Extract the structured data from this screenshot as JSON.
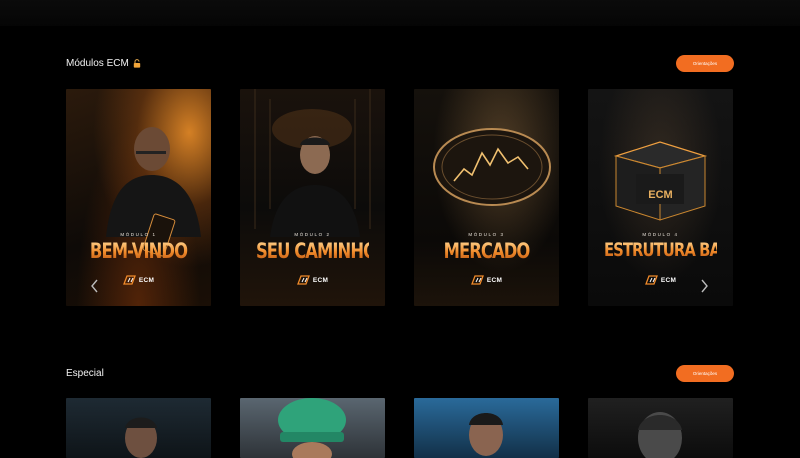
{
  "sections": [
    {
      "title": "Módulos ECM",
      "title_icon": "lock-icon",
      "button_label": "Orientações",
      "cards": [
        {
          "subtitle": "MÓDULO 1",
          "title": "BEM-VINDO",
          "brand": "ECM"
        },
        {
          "subtitle": "MÓDULO 2",
          "title": "SEU CAMINHO",
          "brand": "ECM"
        },
        {
          "subtitle": "MÓDULO 3",
          "title": "MERCADO",
          "brand": "ECM"
        },
        {
          "subtitle": "MÓDULO 4",
          "title": "ESTRUTURA BASE",
          "brand": "ECM",
          "box_label": "ECM"
        }
      ],
      "nav_icons": [
        "chevron-left-icon",
        "chevron-right-icon"
      ]
    },
    {
      "title": "Especial",
      "button_label": "Orientações",
      "cards_count_visible": 4
    }
  ],
  "colors": {
    "accent": "#f26d21",
    "background": "#000000",
    "title_gold": "#f0a24a"
  }
}
